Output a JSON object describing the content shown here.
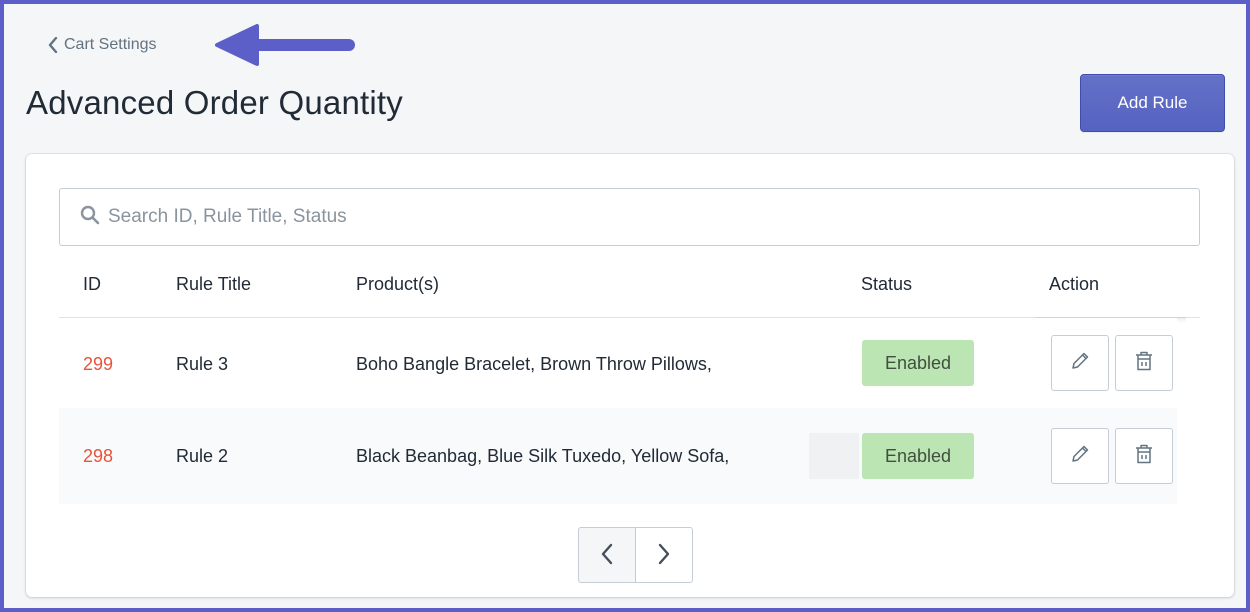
{
  "breadcrumb": {
    "label": "Cart Settings",
    "icon": "chevron-left-icon"
  },
  "page": {
    "title": "Advanced Order Quantity"
  },
  "actions": {
    "add_rule_label": "Add Rule"
  },
  "search": {
    "placeholder": "Search ID, Rule Title, Status",
    "value": "",
    "icon": "search-icon"
  },
  "table": {
    "headers": {
      "id": "ID",
      "title": "Rule Title",
      "products": "Product(s)",
      "status": "Status",
      "action": "Action"
    },
    "rows": [
      {
        "id": "299",
        "title": "Rule 3",
        "products": "Boho Bangle Bracelet, Brown Throw Pillows,",
        "status": "Enabled"
      },
      {
        "id": "298",
        "title": "Rule 2",
        "products": "Black Beanbag, Blue Silk Tuxedo, Yellow Sofa,",
        "status": "Enabled"
      }
    ]
  },
  "pagination": {
    "prev_icon": "chevron-left-icon",
    "next_icon": "chevron-right-icon"
  },
  "colors": {
    "accent": "#5b5fc7",
    "primary_button": "#5563c1",
    "id_text": "#e8533c",
    "badge_bg": "#bbe5b3",
    "background": "#f4f6f8"
  }
}
